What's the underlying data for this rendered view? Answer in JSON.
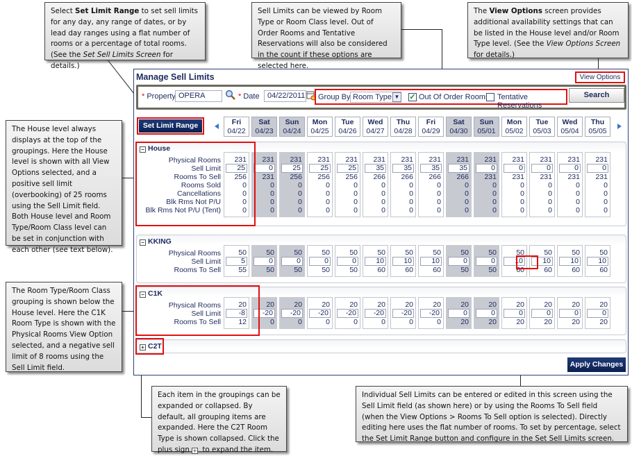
{
  "callouts": {
    "set_limit_range": {
      "pre": "Select ",
      "bold": "Set Limit Range",
      "mid": " to set sell limits for any day, any range of dates, or by lead day ranges using  a flat number of rooms or a percentage of total rooms. (See  the ",
      "italic": "Set Sell Limits Screen",
      "post": " for details.)"
    },
    "group_by": "Sell Limits can be viewed by Room Type or Room Class level. Out of Order Rooms and Tentative Reservations will also be considered in the count if these options  are selected here.",
    "view_options": {
      "pre": "The ",
      "bold": "View Options",
      "mid": " screen provides additional availability settings that can be listed in the House  level and/or Room Type level. (See the ",
      "italic": "View Options Screen",
      "post": " for details.)"
    },
    "house": "The House level always displays at the top of the groupings. Here the House level is shown with all View Options selected, and a positive sell limit (overbooking) of 25 rooms using the Sell Limit field. Both House level and Room Type/Room Class level can be set in conjunction  with each other (see text below).",
    "room_type": "The Room Type/Room Class grouping is shown below the House level. Here the C1K Room Type is shown with  the Physical Rooms View Option selected, and a negative sell limit of 8 rooms using the Sell Limit field.",
    "expand": {
      "pre": "Each item in the groupings can be expanded or collapsed. By default, all grouping items are expanded. Here the C2T Room Type is shown collapsed. Click the plus sign ",
      "icon": "+",
      "post": " to expand the item."
    },
    "individual": "Individual Sell Limits can be entered or edited in this screen using the Sell Limit field (as shown here) or by using the Rooms To Sell field (when the View Options > Rooms To Sell option is selected). Directly editing here uses the flat number of rooms. To set by percentage, select  the Set Limit Range button and configure in the Set Sell Limits screen."
  },
  "window": {
    "title": "Manage Sell Limits",
    "view_options_link": "View Options",
    "property_label": "Property",
    "property_value": "OPERA",
    "date_label": "Date",
    "date_value": "04/22/2011",
    "group_by_label": "Group By",
    "group_by_value": "Room Type",
    "out_of_order_label": "Out Of Order Rooms",
    "out_of_order_checked": true,
    "tentative_label": "Tentative Reservations",
    "tentative_checked": false,
    "search_button": "Search",
    "set_limit_range_button": "Set Limit Range",
    "apply_changes_button": "Apply Changes",
    "required_mark": "*"
  },
  "dates": [
    {
      "dow": "Fri",
      "date": "04/22",
      "weekend": false
    },
    {
      "dow": "Sat",
      "date": "04/23",
      "weekend": true
    },
    {
      "dow": "Sun",
      "date": "04/24",
      "weekend": true
    },
    {
      "dow": "Mon",
      "date": "04/25",
      "weekend": false
    },
    {
      "dow": "Tue",
      "date": "04/26",
      "weekend": false
    },
    {
      "dow": "Wed",
      "date": "04/27",
      "weekend": false
    },
    {
      "dow": "Thu",
      "date": "04/28",
      "weekend": false
    },
    {
      "dow": "Fri",
      "date": "04/29",
      "weekend": false
    },
    {
      "dow": "Sat",
      "date": "04/30",
      "weekend": true
    },
    {
      "dow": "Sun",
      "date": "05/01",
      "weekend": true
    },
    {
      "dow": "Mon",
      "date": "05/02",
      "weekend": false
    },
    {
      "dow": "Tue",
      "date": "05/03",
      "weekend": false
    },
    {
      "dow": "Wed",
      "date": "05/04",
      "weekend": false
    },
    {
      "dow": "Thu",
      "date": "05/05",
      "weekend": false
    }
  ],
  "groups": [
    {
      "name": "House",
      "expanded": true,
      "toggle": "−",
      "rows": [
        "Physical Rooms",
        "Sell Limit",
        "Rooms To Sell",
        "Rooms Sold",
        "Cancellations",
        "Blk Rms Not P/U",
        "Blk Rms Not P/U (Tent)"
      ],
      "values": [
        [
          "231",
          "25",
          "256",
          "0",
          "0",
          "0",
          "0"
        ],
        [
          "231",
          "0",
          "231",
          "0",
          "0",
          "0",
          "0"
        ],
        [
          "231",
          "25",
          "256",
          "0",
          "0",
          "0",
          "0"
        ],
        [
          "231",
          "25",
          "256",
          "0",
          "0",
          "0",
          "0"
        ],
        [
          "231",
          "25",
          "256",
          "0",
          "0",
          "0",
          "0"
        ],
        [
          "231",
          "35",
          "266",
          "0",
          "0",
          "0",
          "0"
        ],
        [
          "231",
          "35",
          "266",
          "0",
          "0",
          "0",
          "0"
        ],
        [
          "231",
          "35",
          "266",
          "0",
          "0",
          "0",
          "0"
        ],
        [
          "231",
          "35",
          "266",
          "0",
          "0",
          "0",
          "0"
        ],
        [
          "231",
          "0",
          "231",
          "0",
          "0",
          "0",
          "0"
        ],
        [
          "231",
          "0",
          "231",
          "0",
          "0",
          "0",
          "0"
        ],
        [
          "231",
          "0",
          "231",
          "0",
          "0",
          "0",
          "0"
        ],
        [
          "231",
          "0",
          "231",
          "0",
          "0",
          "0",
          "0"
        ],
        [
          "231",
          "0",
          "231",
          "0",
          "0",
          "0",
          "0"
        ]
      ]
    },
    {
      "name": "KKING",
      "expanded": true,
      "toggle": "−",
      "rows": [
        "Physical Rooms",
        "Sell Limit",
        "Rooms To Sell"
      ],
      "values": [
        [
          "50",
          "5",
          "55"
        ],
        [
          "50",
          "0",
          "50"
        ],
        [
          "50",
          "0",
          "50"
        ],
        [
          "50",
          "0",
          "50"
        ],
        [
          "50",
          "0",
          "50"
        ],
        [
          "50",
          "10",
          "60"
        ],
        [
          "50",
          "10",
          "60"
        ],
        [
          "50",
          "10",
          "60"
        ],
        [
          "50",
          "0",
          "50"
        ],
        [
          "50",
          "0",
          "50"
        ],
        [
          "50",
          "10",
          "60"
        ],
        [
          "50",
          "10",
          "60"
        ],
        [
          "50",
          "10",
          "60"
        ],
        [
          "50",
          "10",
          "60"
        ]
      ]
    },
    {
      "name": "C1K",
      "expanded": true,
      "toggle": "−",
      "rows": [
        "Physical Rooms",
        "Sell Limit",
        "Rooms To Sell"
      ],
      "values": [
        [
          "20",
          "-8",
          "12"
        ],
        [
          "20",
          "-20",
          "0"
        ],
        [
          "20",
          "-20",
          "0"
        ],
        [
          "20",
          "-20",
          "0"
        ],
        [
          "20",
          "-20",
          "0"
        ],
        [
          "20",
          "-20",
          "0"
        ],
        [
          "20",
          "-20",
          "0"
        ],
        [
          "20",
          "-20",
          "0"
        ],
        [
          "20",
          "0",
          "20"
        ],
        [
          "20",
          "0",
          "20"
        ],
        [
          "20",
          "0",
          "20"
        ],
        [
          "20",
          "0",
          "20"
        ],
        [
          "20",
          "0",
          "20"
        ],
        [
          "20",
          "0",
          "20"
        ]
      ]
    },
    {
      "name": "C2T",
      "expanded": false,
      "toggle": "+",
      "rows": [],
      "values": []
    }
  ],
  "colors": {
    "highlight": "#e01010",
    "button_navy": "#0c1f52",
    "weekend_gray": "#c8cad2",
    "text_navy": "#1d2a5c"
  }
}
